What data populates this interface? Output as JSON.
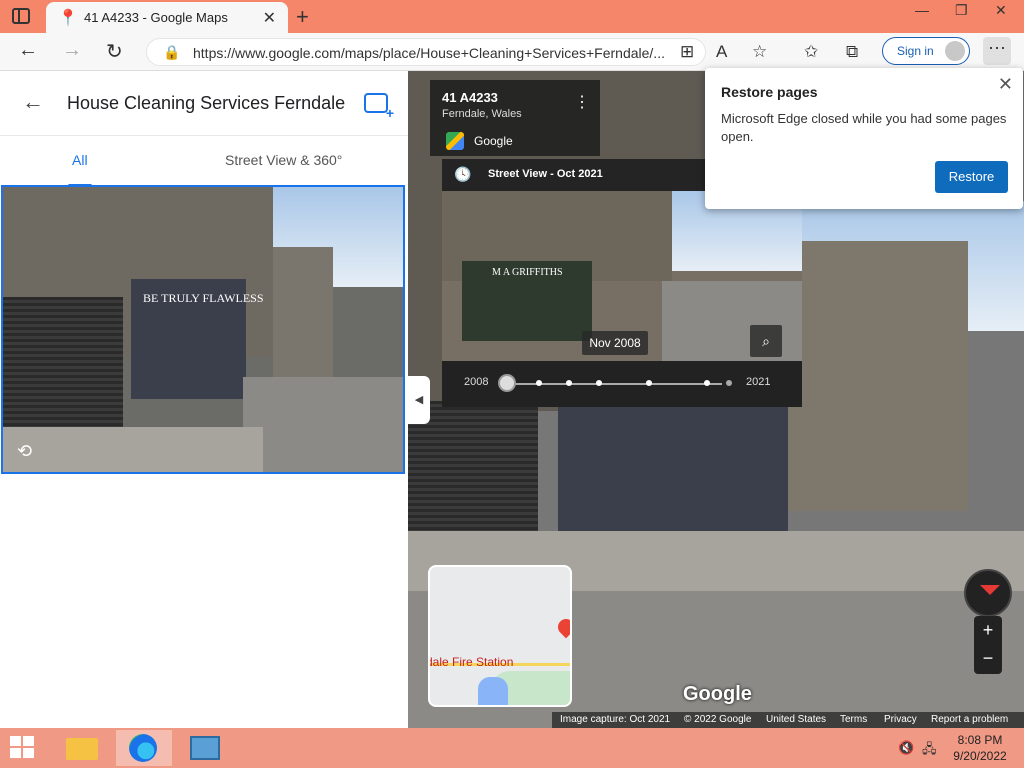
{
  "browser": {
    "tab_title": "41 A4233 - Google Maps",
    "tab_close": "✕",
    "new_tab": "+",
    "url": "https://www.google.com/maps/place/House+Cleaning+Services+Ferndale/...",
    "sign_in": "Sign in",
    "more": "⋯",
    "window_controls": [
      "—",
      "❐",
      "✕"
    ]
  },
  "left_panel": {
    "title": "House Cleaning Services Ferndale",
    "tabs": [
      {
        "label": "All",
        "active": true
      },
      {
        "label": "Street View & 360°",
        "active": false
      }
    ],
    "shop_sign": "BE TRULY FLAWLESS"
  },
  "street_view": {
    "address": "41 A4233",
    "locality": "Ferndale, Wales",
    "provider": "Google",
    "view_label": "Street View - Oct 2021",
    "time_machine": {
      "shop_sign": "M A GRIFFITHS",
      "date_label": "Nov 2008",
      "year_start": "2008",
      "year_end": "2021"
    },
    "minimap_label": "dale Fire Station",
    "watermark": "Google",
    "footer": [
      "Image capture: Oct 2021",
      "© 2022 Google",
      "United States",
      "Terms",
      "Privacy",
      "Report a problem"
    ]
  },
  "popup": {
    "title": "Restore pages",
    "message": "Microsoft Edge closed while you had some pages open.",
    "button": "Restore"
  },
  "taskbar": {
    "time": "8:08 PM",
    "date": "9/20/2022"
  }
}
